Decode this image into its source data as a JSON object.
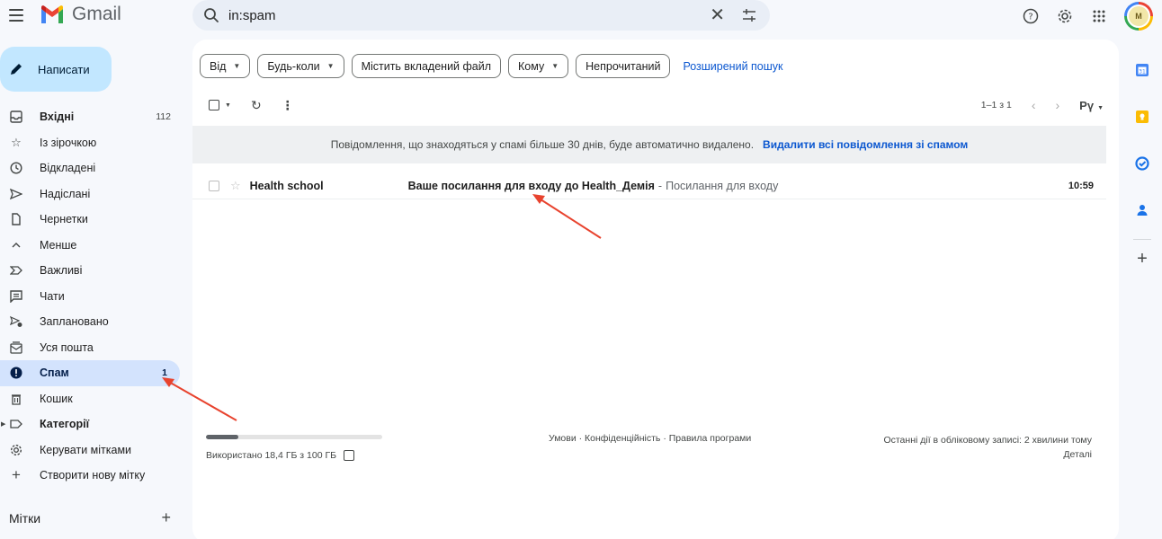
{
  "app": {
    "name": "Gmail"
  },
  "search": {
    "value": "in:spam"
  },
  "compose": {
    "label": "Написати"
  },
  "sidebar": {
    "items": [
      {
        "label": "Вхідні",
        "count": "112"
      },
      {
        "label": "Із зірочкою",
        "count": ""
      },
      {
        "label": "Відкладені",
        "count": ""
      },
      {
        "label": "Надіслані",
        "count": ""
      },
      {
        "label": "Чернетки",
        "count": ""
      },
      {
        "label": "Менше",
        "count": ""
      },
      {
        "label": "Важливі",
        "count": ""
      },
      {
        "label": "Чати",
        "count": ""
      },
      {
        "label": "Заплановано",
        "count": ""
      },
      {
        "label": "Уся пошта",
        "count": ""
      },
      {
        "label": "Спам",
        "count": "1"
      },
      {
        "label": "Кошик",
        "count": ""
      },
      {
        "label": "Категорії",
        "count": ""
      },
      {
        "label": "Керувати мітками",
        "count": ""
      },
      {
        "label": "Створити нову мітку",
        "count": ""
      }
    ],
    "labels_heading": "Мітки"
  },
  "filters": {
    "from": "Від",
    "any_time": "Будь-коли",
    "has_attachment": "Містить вкладений файл",
    "to": "Кому",
    "unread": "Непрочитаний",
    "advanced_search": "Розширений пошук"
  },
  "toolbar": {
    "page_info": "1–1 з 1",
    "input_lang": "Рү"
  },
  "banner": {
    "text": "Повідомлення, що знаходяться у спамі більше 30 днів, буде автоматично видалено.",
    "link": "Видалити всі повідомлення зі спамом"
  },
  "messages": [
    {
      "sender": "Health school",
      "subject": "Ваше посилання для входу до Health_Демія",
      "separator": "-",
      "snippet": "Посилання для входу",
      "time": "10:59"
    }
  ],
  "footer": {
    "storage_text": "Використано 18,4 ГБ з 100 ГБ",
    "storage_fraction": 0.184,
    "links": "Умови · Конфіденційність · Правила програми",
    "last_activity": "Останні дії в обліковому записі: 2 хвилини тому",
    "details": "Деталі"
  },
  "avatar": {
    "initial": "М"
  },
  "colors": {
    "compose_bg": "#c2e7ff",
    "active_nav_bg": "#d3e3fd",
    "link_blue": "#0b57d0",
    "annotation_red": "#e8432e"
  },
  "icons": {
    "top": [
      "help-icon",
      "settings-icon",
      "apps-grid-icon"
    ],
    "rail": [
      "calendar-icon",
      "keep-icon",
      "tasks-icon",
      "contacts-icon"
    ]
  }
}
